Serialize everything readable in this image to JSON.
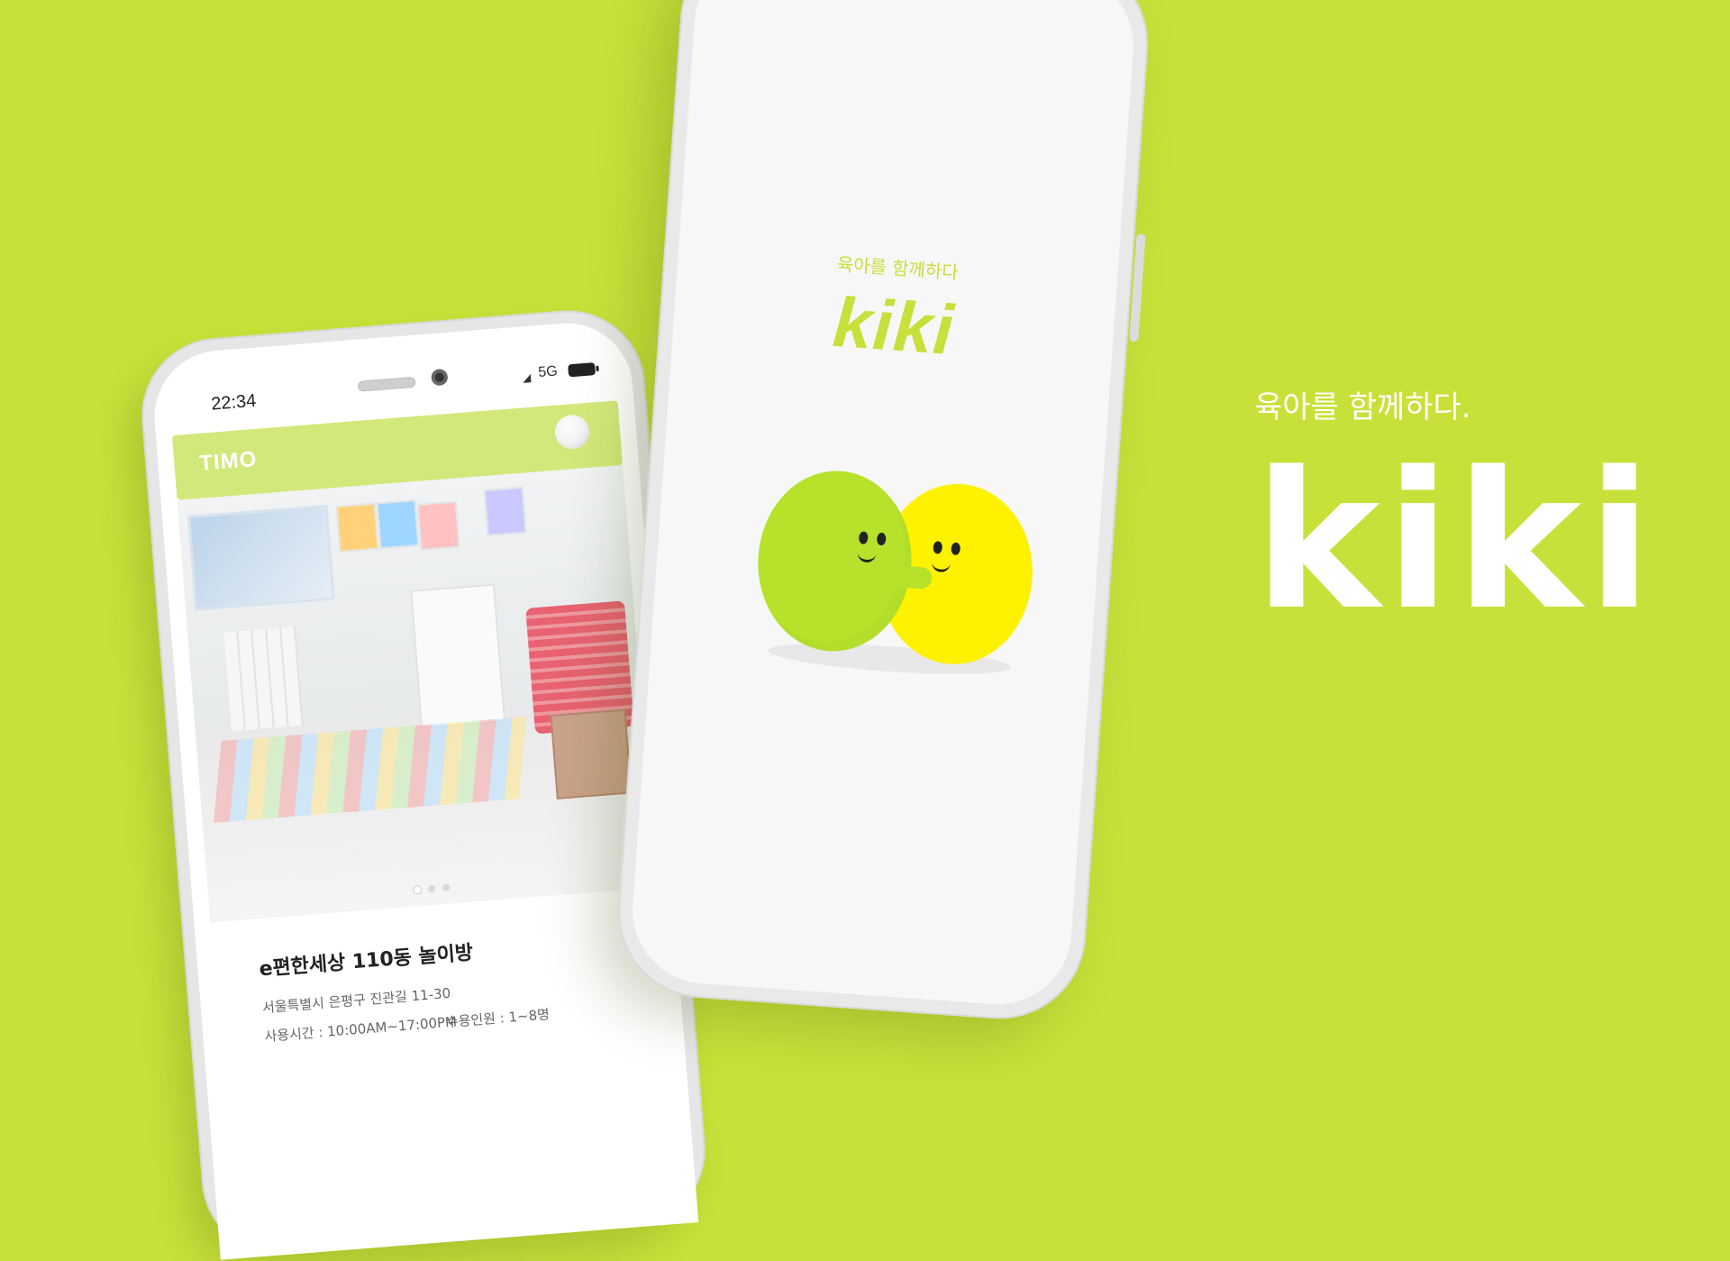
{
  "colors": {
    "background": "#c8e13a",
    "accent": "#c8df3c",
    "mascot_green": "#b6e22b",
    "mascot_yellow": "#fff200"
  },
  "left_phone": {
    "status_bar": {
      "time": "22:34",
      "network": "5G",
      "signal_icon": "signal-icon",
      "battery_icon": "battery-icon"
    },
    "header": {
      "logo": "TIMO",
      "avatar_icon": "avatar-icon"
    },
    "carousel": {
      "active_index": 1,
      "total": 3
    },
    "place": {
      "title": "e편한세상 110동 놀이방",
      "address": "서울특별시 은평구 진관길 11-30",
      "hours": "사용시간 : 10:00AM~17:00PM",
      "capacity": "수용인원 : 1~8명"
    }
  },
  "middle_phone": {
    "tagline": "육아를 함께하다",
    "logo": "kiki"
  },
  "branding": {
    "tagline": "육아를 함께하다.",
    "logo": "kiki"
  }
}
